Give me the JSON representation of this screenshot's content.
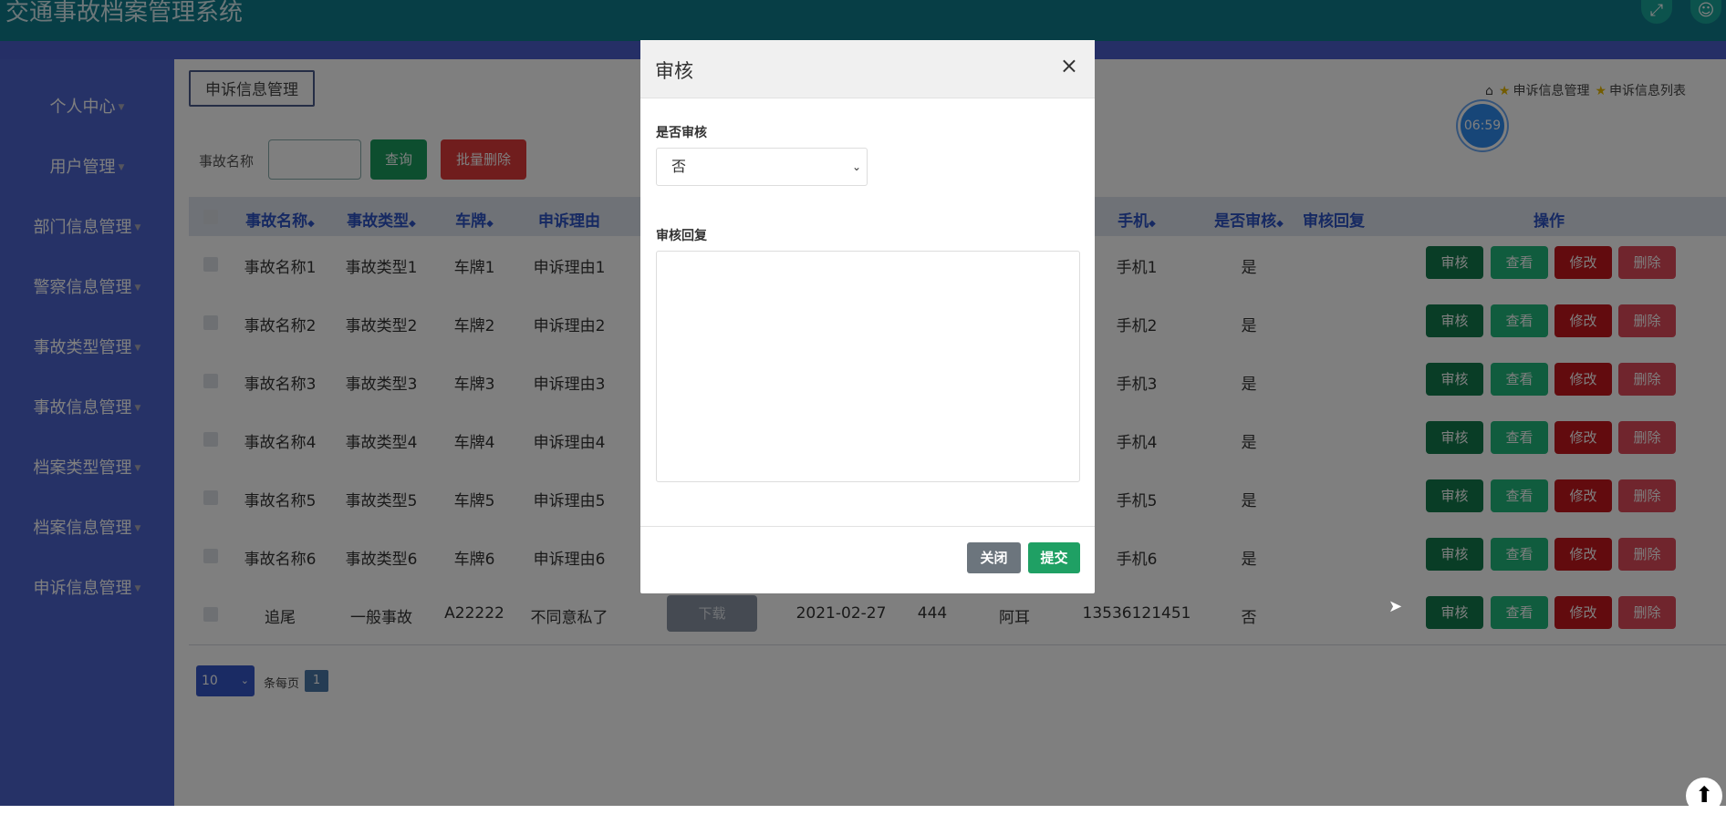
{
  "app": {
    "title": "交通事故档案管理系统",
    "expand_icon": "expand-icon",
    "user_icon": "user-icon"
  },
  "sidebar": {
    "items": [
      {
        "label": "个人中心"
      },
      {
        "label": "用户管理"
      },
      {
        "label": "部门信息管理"
      },
      {
        "label": "警察信息管理"
      },
      {
        "label": "事故类型管理"
      },
      {
        "label": "事故信息管理"
      },
      {
        "label": "档案类型管理"
      },
      {
        "label": "档案信息管理"
      },
      {
        "label": "申诉信息管理"
      }
    ]
  },
  "page": {
    "crumb_box": "申诉信息管理",
    "breadcrumbs": [
      "申诉信息管理",
      "申诉信息列表"
    ],
    "timer": "06:59"
  },
  "search": {
    "label": "事故名称",
    "value": "",
    "query_button": "查询",
    "batch_delete_button": "批量删除"
  },
  "table": {
    "headers": [
      "事故名称",
      "事故类型",
      "车牌",
      "申诉理由",
      "手机",
      "是否审核",
      "审核回复",
      "操作"
    ],
    "actions": {
      "audit": "审核",
      "view": "查看",
      "edit": "修改",
      "delete": "删除"
    },
    "rows": [
      {
        "name": "事故名称1",
        "type": "事故类型1",
        "plate": "车牌1",
        "reason": "申诉理由1",
        "phone": "手机1",
        "audited": "是"
      },
      {
        "name": "事故名称2",
        "type": "事故类型2",
        "plate": "车牌2",
        "reason": "申诉理由2",
        "phone": "手机2",
        "audited": "是"
      },
      {
        "name": "事故名称3",
        "type": "事故类型3",
        "plate": "车牌3",
        "reason": "申诉理由3",
        "phone": "手机3",
        "audited": "是"
      },
      {
        "name": "事故名称4",
        "type": "事故类型4",
        "plate": "车牌4",
        "reason": "申诉理由4",
        "phone": "手机4",
        "audited": "是"
      },
      {
        "name": "事故名称5",
        "type": "事故类型5",
        "plate": "车牌5",
        "reason": "申诉理由5",
        "phone": "手机5",
        "audited": "是"
      },
      {
        "name": "事故名称6",
        "type": "事故类型6",
        "plate": "车牌6",
        "reason": "申诉理由6",
        "phone": "手机6",
        "audited": "是"
      },
      {
        "name": "追尾",
        "type": "一般事故",
        "plate": "A22222",
        "reason": "不同意私了",
        "download": "下载",
        "date": "2021-02-27",
        "number": "444",
        "person": "阿耳",
        "phone": "13536121451",
        "audited": "否"
      }
    ]
  },
  "pager": {
    "page_size": "10",
    "per_page_text": "条每页",
    "current_page": "1"
  },
  "modal": {
    "title": "审核",
    "close_symbol": "×",
    "audit_label": "是否审核",
    "audit_value": "否",
    "reply_label": "审核回复",
    "reply_value": "",
    "close_button": "关闭",
    "submit_button": "提交"
  }
}
